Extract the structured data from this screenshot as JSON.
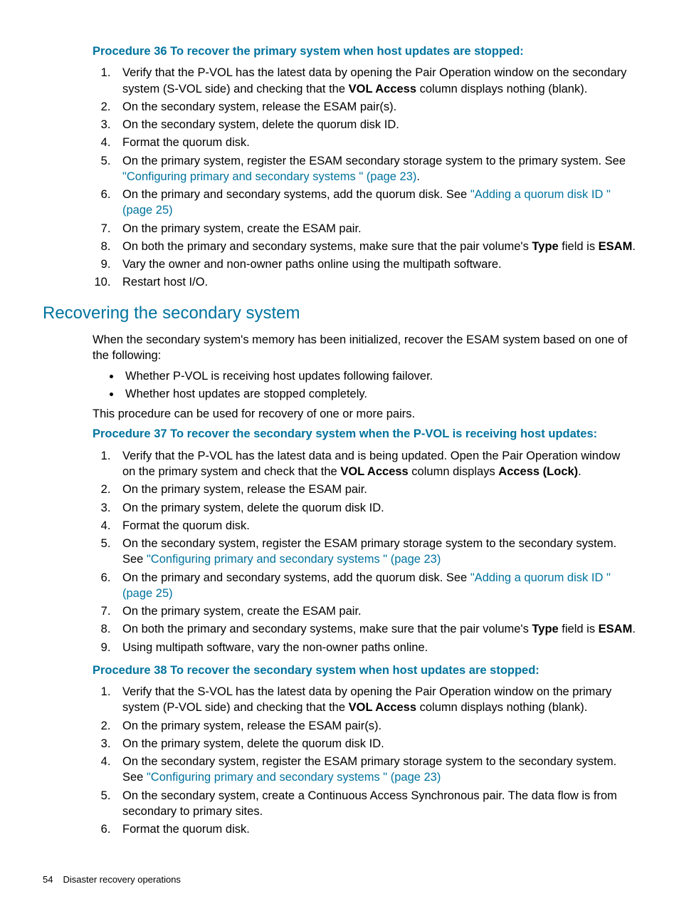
{
  "proc36": {
    "title": "Procedure 36 To recover the primary system when host updates are stopped:",
    "items": [
      {
        "pre": "Verify that the P-VOL has the latest data by opening the Pair Operation window on the secondary system (S-VOL side) and checking that the ",
        "b1": "VOL Access",
        "post": " column displays nothing (blank)."
      },
      {
        "text": "On the secondary system, release the ESAM pair(s)."
      },
      {
        "text": "On the secondary system, delete the quorum disk ID."
      },
      {
        "text": "Format the quorum disk."
      },
      {
        "pre": "On the primary system, register the ESAM secondary storage system to the primary system. See ",
        "link": "\"Configuring primary and secondary systems \" (page 23)",
        "post": "."
      },
      {
        "pre": "On the primary and secondary systems, add the quorum disk. See ",
        "link": "\"Adding a quorum disk ID \" (page 25)"
      },
      {
        "text": "On the primary system, create the ESAM pair."
      },
      {
        "pre": "On both the primary and secondary systems, make sure that the pair volume's ",
        "b1": "Type",
        "mid": " field is ",
        "b2": "ESAM",
        "post": "."
      },
      {
        "text": "Vary the owner and non-owner paths online using the multipath software."
      },
      {
        "text": "Restart host I/O."
      }
    ]
  },
  "section": {
    "title": "Recovering the secondary system",
    "intro": "When the secondary system's memory has been initialized, recover the ESAM system based on one of the following:",
    "bullets": [
      "Whether P-VOL is receiving host updates following failover.",
      "Whether host updates are stopped completely."
    ],
    "note": "This procedure can be used for recovery of one or more pairs."
  },
  "proc37": {
    "title": "Procedure 37 To recover the secondary system when the P-VOL is receiving host updates:",
    "items": [
      {
        "pre": "Verify that the P-VOL has the latest data and is being updated. Open the Pair Operation window on the primary system and check that the ",
        "b1": "VOL Access",
        "mid": " column displays ",
        "b2": "Access (Lock)",
        "post": "."
      },
      {
        "text": "On the primary system, release the ESAM pair."
      },
      {
        "text": "On the primary system, delete the quorum disk ID."
      },
      {
        "text": "Format the quorum disk."
      },
      {
        "pre": "On the secondary system, register the ESAM primary storage system to the secondary system. See ",
        "link": "\"Configuring primary and secondary systems \" (page 23)"
      },
      {
        "pre": "On the primary and secondary systems, add the quorum disk. See ",
        "link": "\"Adding a quorum disk ID \" (page 25)"
      },
      {
        "text": "On the primary system, create the ESAM pair."
      },
      {
        "pre": "On both the primary and secondary systems, make sure that the pair volume's ",
        "b1": "Type",
        "mid": " field is ",
        "b2": "ESAM",
        "post": "."
      },
      {
        "text": "Using multipath software, vary the non-owner paths online."
      }
    ]
  },
  "proc38": {
    "title": "Procedure 38 To recover the secondary system when host updates are stopped:",
    "items": [
      {
        "pre": "Verify that the S-VOL has the latest data by opening the Pair Operation window on the primary system (P-VOL side) and checking that the ",
        "b1": "VOL Access",
        "post": " column displays nothing (blank)."
      },
      {
        "text": "On the primary system, release the ESAM pair(s)."
      },
      {
        "text": "On the primary system, delete the quorum disk ID."
      },
      {
        "pre": "On the secondary system, register the ESAM primary storage system to the secondary system. See ",
        "link": "\"Configuring primary and secondary systems \" (page 23)"
      },
      {
        "text": "On the secondary system, create a Continuous Access Synchronous pair. The data flow is from secondary to primary sites."
      },
      {
        "text": "Format the quorum disk."
      }
    ]
  },
  "footer": {
    "page": "54",
    "chapter": "Disaster recovery operations"
  }
}
